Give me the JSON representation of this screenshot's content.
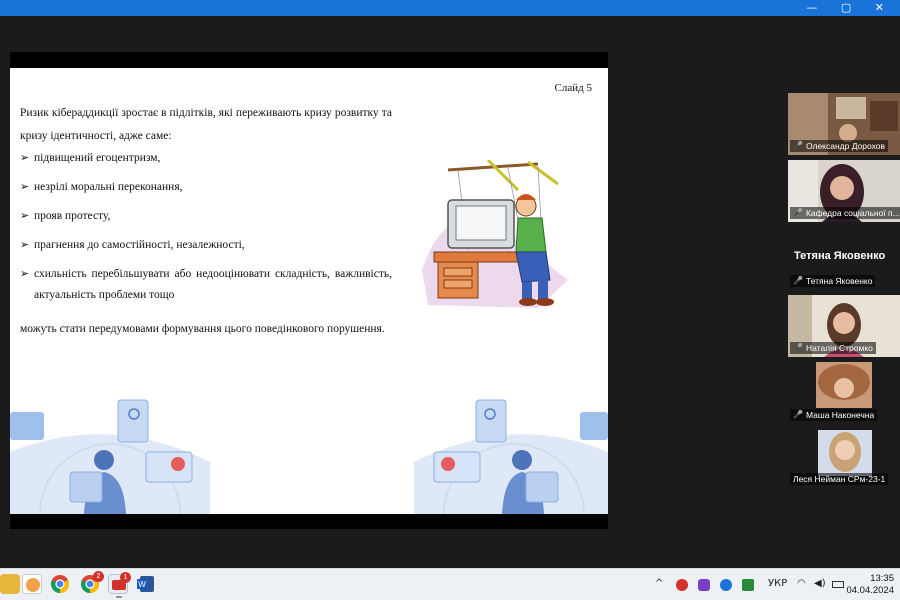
{
  "window": {
    "controls": "— ▢ ✕"
  },
  "slide": {
    "number": "Слайд 5",
    "intro": "Ризик кібераддикції зростає в підлітків, які переживають кризу розвитку та кризу ідентичності, адже саме:",
    "bullet_symbol": "➢",
    "items": [
      "підвищений егоцентризм,",
      "незрілі моральні переконання,",
      "прояв протесту,",
      "прагнення до самостійності, незалежності,",
      "схильність перебільшувати або недооцінювати складність, важливість, актуальність проблеми тощо"
    ],
    "conclusion": "можуть стати передумовами формування цього поведінкового порушення."
  },
  "participants": [
    {
      "name": "Олександр Дорохов",
      "muted": true
    },
    {
      "name": "Кафедра соціальної п...",
      "muted": true
    },
    {
      "display_name": "Тетяна Яковенко",
      "name": "Тетяна Яковенко",
      "muted": true
    },
    {
      "name": "Наталія Стромко",
      "muted": true
    },
    {
      "name": "Маша Наконечна",
      "muted": true
    },
    {
      "name": "Леся Нейман СРм-23-1",
      "muted": false,
      "active": true
    }
  ],
  "taskbar": {
    "badges": [
      "2",
      "1"
    ],
    "tray": {
      "chevron": "^",
      "language": "УКР"
    },
    "clock": {
      "time": "13:35",
      "date": "04.04.2024"
    }
  },
  "icons": [
    "mic-muted-icon",
    "chrome-icon",
    "word-icon",
    "wifi-icon",
    "volume-icon",
    "battery-icon"
  ]
}
